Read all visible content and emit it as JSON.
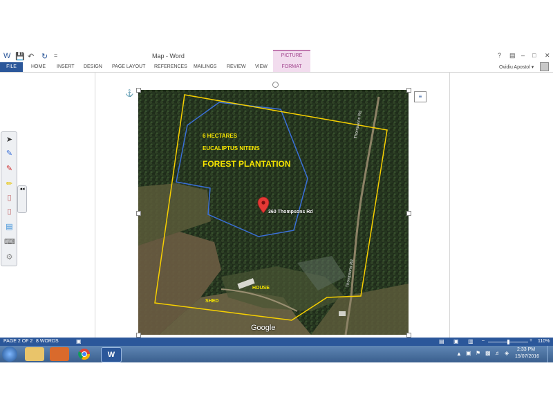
{
  "window": {
    "doc_title": "Map - Word",
    "context_tab_title": "PICTURE TOOLS",
    "help_label": "?",
    "min_label": "–",
    "max_label": "□",
    "close_label": "✕"
  },
  "ribbon": {
    "tabs": [
      "FILE",
      "HOME",
      "INSERT",
      "DESIGN",
      "PAGE LAYOUT",
      "REFERENCES",
      "MAILINGS",
      "REVIEW",
      "VIEW",
      "FORMAT"
    ],
    "user_name": "Ovidiu Apostol ▾"
  },
  "map": {
    "area_label": "6 HECTARES",
    "species_label": "EUCALIPTUS NITENS",
    "type_label": "FOREST PLANTATION",
    "pin_label": "360 Thompsons Rd",
    "road_label_1": "Thompsons Rd",
    "road_label_2": "Thompsons Rd",
    "house_label": "HOUSE",
    "shed_label": "SHED",
    "google_label": "Google"
  },
  "pen_tools": [
    "select-arrow-icon",
    "pen-icon",
    "pen-alt-icon",
    "highlighter-icon",
    "eraser-icon",
    "eraser-alt-icon",
    "note-icon",
    "keyboard-icon",
    "settings-icon"
  ],
  "pen_collapse_label": "◂◂",
  "status": {
    "page": "PAGE 2 OF 2",
    "words": "8 WORDS",
    "zoom": "110%",
    "zoom_minus": "–",
    "zoom_plus": "+"
  },
  "taskbar": {
    "time": "2:33 PM",
    "date": "15/07/2016"
  },
  "colors": {
    "word_blue": "#2b579a",
    "format_pink": "#f2dcee",
    "boundary_yellow": "#f7d000",
    "forest_blue_line": "#3a6fd8"
  }
}
